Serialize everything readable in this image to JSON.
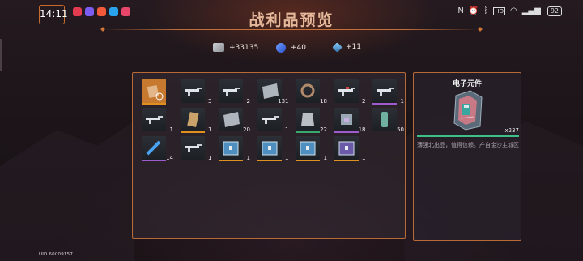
{
  "status_bar": {
    "time": "14:11",
    "battery": "92",
    "app_icon_colors": [
      "#e23b4f",
      "#7a5cf0",
      "#f05a3a",
      "#2aa3ee",
      "#e8466b"
    ],
    "sys_icons": [
      "nfc-icon",
      "alarm-icon",
      "bluetooth-icon",
      "hd-icon",
      "wifi-icon",
      "signal-icon",
      "battery-icon"
    ]
  },
  "header": {
    "title": "战利品预览"
  },
  "currencies": [
    {
      "icon": "cash-icon",
      "value": "+33135",
      "color": "#b9bcc0"
    },
    {
      "icon": "blue-gem-icon",
      "value": "+40",
      "color": "#3a6ef0"
    },
    {
      "icon": "blue-cube-icon",
      "value": "+11",
      "color": "#5aa7e0"
    }
  ],
  "loot": {
    "rows": [
      [
        {
          "icon": "selected-orange-item-icon",
          "count": "",
          "rarity": "orange",
          "selected": true
        },
        {
          "icon": "rifle-icon",
          "count": "3",
          "rarity": "none"
        },
        {
          "icon": "rifle-icon",
          "count": "2",
          "rarity": "none"
        },
        {
          "icon": "metal-plate-icon",
          "count": "131",
          "rarity": "none"
        },
        {
          "icon": "ring-part-icon",
          "count": "18",
          "rarity": "none"
        },
        {
          "icon": "gun-red-icon",
          "count": "2",
          "rarity": "none"
        },
        {
          "icon": "rifle-icon",
          "count": "1",
          "rarity": "purple"
        }
      ],
      [
        {
          "icon": "rifle-icon",
          "count": "1",
          "rarity": "none"
        },
        {
          "icon": "tag-card-icon",
          "count": "1",
          "rarity": "orange"
        },
        {
          "icon": "steel-plate-icon",
          "count": "20",
          "rarity": "none"
        },
        {
          "icon": "rifle-icon",
          "count": "1",
          "rarity": "none"
        },
        {
          "icon": "vest-icon",
          "count": "22",
          "rarity": "green"
        },
        {
          "icon": "chip-icon",
          "count": "18",
          "rarity": "purple"
        },
        {
          "icon": "canister-icon",
          "count": "50",
          "rarity": "none"
        }
      ],
      [
        {
          "icon": "blue-tool-icon",
          "count": "14",
          "rarity": "purple"
        },
        {
          "icon": "rifle-icon",
          "count": "1",
          "rarity": "none"
        },
        {
          "icon": "crate-blue-icon",
          "count": "1",
          "rarity": "orange"
        },
        {
          "icon": "crate-blue-icon",
          "count": "1",
          "rarity": "orange"
        },
        {
          "icon": "crate-blue-icon",
          "count": "1",
          "rarity": "orange"
        },
        {
          "icon": "crate-purple-icon",
          "count": "1",
          "rarity": "orange"
        }
      ]
    ]
  },
  "detail": {
    "name": "电子元件",
    "quantity": "x237",
    "description": "薄强北出品，值得信赖。产自金沙主城区",
    "icon": "electronic-parts-icon"
  },
  "footer": {
    "uid": "UID 60009157"
  },
  "colors": {
    "accent": "#c86f32",
    "orange": "#e0901f",
    "purple": "#a05ad0",
    "green": "#3aa86c",
    "bar": "#3fbf88"
  }
}
